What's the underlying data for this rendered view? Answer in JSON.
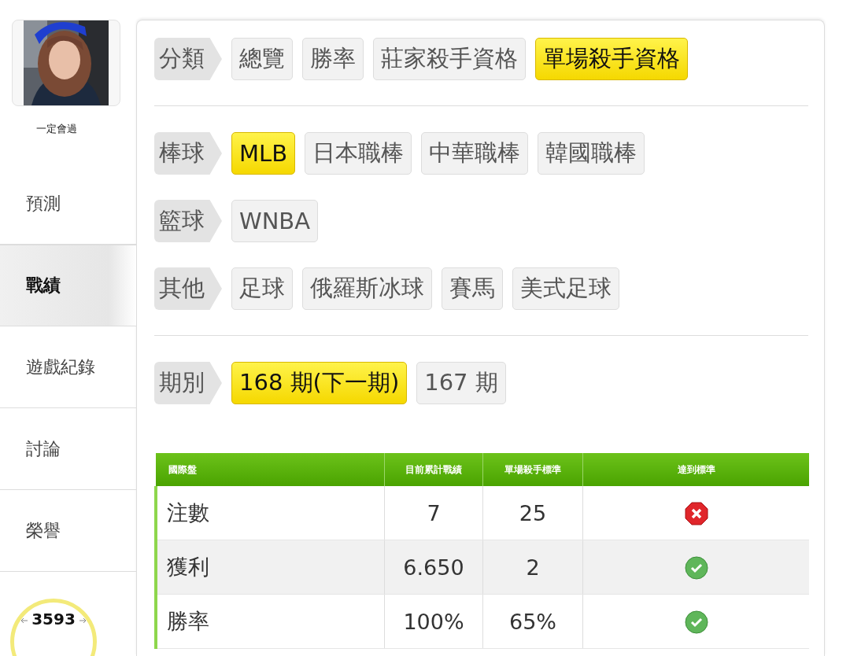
{
  "profile": {
    "kind": "picture",
    "name": "一定會過"
  },
  "nav": [
    {
      "label": "預測",
      "selected": false
    },
    {
      "label": "戰績",
      "selected": true
    },
    {
      "label": "遊戲紀錄",
      "selected": false
    },
    {
      "label": "討論",
      "selected": false
    },
    {
      "label": "榮譽",
      "selected": false
    }
  ],
  "score_badge": "3593",
  "filter_sections": [
    {
      "groups": [
        {
          "label": "分類",
          "options": [
            {
              "label": "總覽",
              "selected": false
            },
            {
              "label": "勝率",
              "selected": false
            },
            {
              "label": "莊家殺手資格",
              "selected": false
            },
            {
              "label": "單場殺手資格",
              "selected": true
            }
          ]
        }
      ]
    },
    {
      "groups": [
        {
          "label": "棒球",
          "options": [
            {
              "label": "MLB",
              "selected": true
            },
            {
              "label": "日本職棒",
              "selected": false
            },
            {
              "label": "中華職棒",
              "selected": false
            },
            {
              "label": "韓國職棒",
              "selected": false
            }
          ]
        },
        {
          "label": "籃球",
          "options": [
            {
              "label": "WNBA",
              "selected": false
            }
          ]
        },
        {
          "label": "其他",
          "options": [
            {
              "label": "足球",
              "selected": false
            },
            {
              "label": "俄羅斯冰球",
              "selected": false
            },
            {
              "label": "賽馬",
              "selected": false
            },
            {
              "label": "美式足球",
              "selected": false
            }
          ]
        }
      ]
    },
    {
      "groups": [
        {
          "label": "期別",
          "options": [
            {
              "label": "168 期(下一期)",
              "selected": true
            },
            {
              "label": "167 期",
              "selected": false
            }
          ]
        }
      ]
    }
  ],
  "table": {
    "columns": [
      "國際盤",
      "目前累計戰績",
      "單場殺手標準",
      "達到標準"
    ],
    "rows": [
      {
        "label": "注數",
        "current": "7",
        "standard": "25",
        "met": false
      },
      {
        "label": "獲利",
        "current": "6.650",
        "standard": "2",
        "met": true
      },
      {
        "label": "勝率",
        "current": "100%",
        "standard": "65%",
        "met": true
      }
    ]
  }
}
